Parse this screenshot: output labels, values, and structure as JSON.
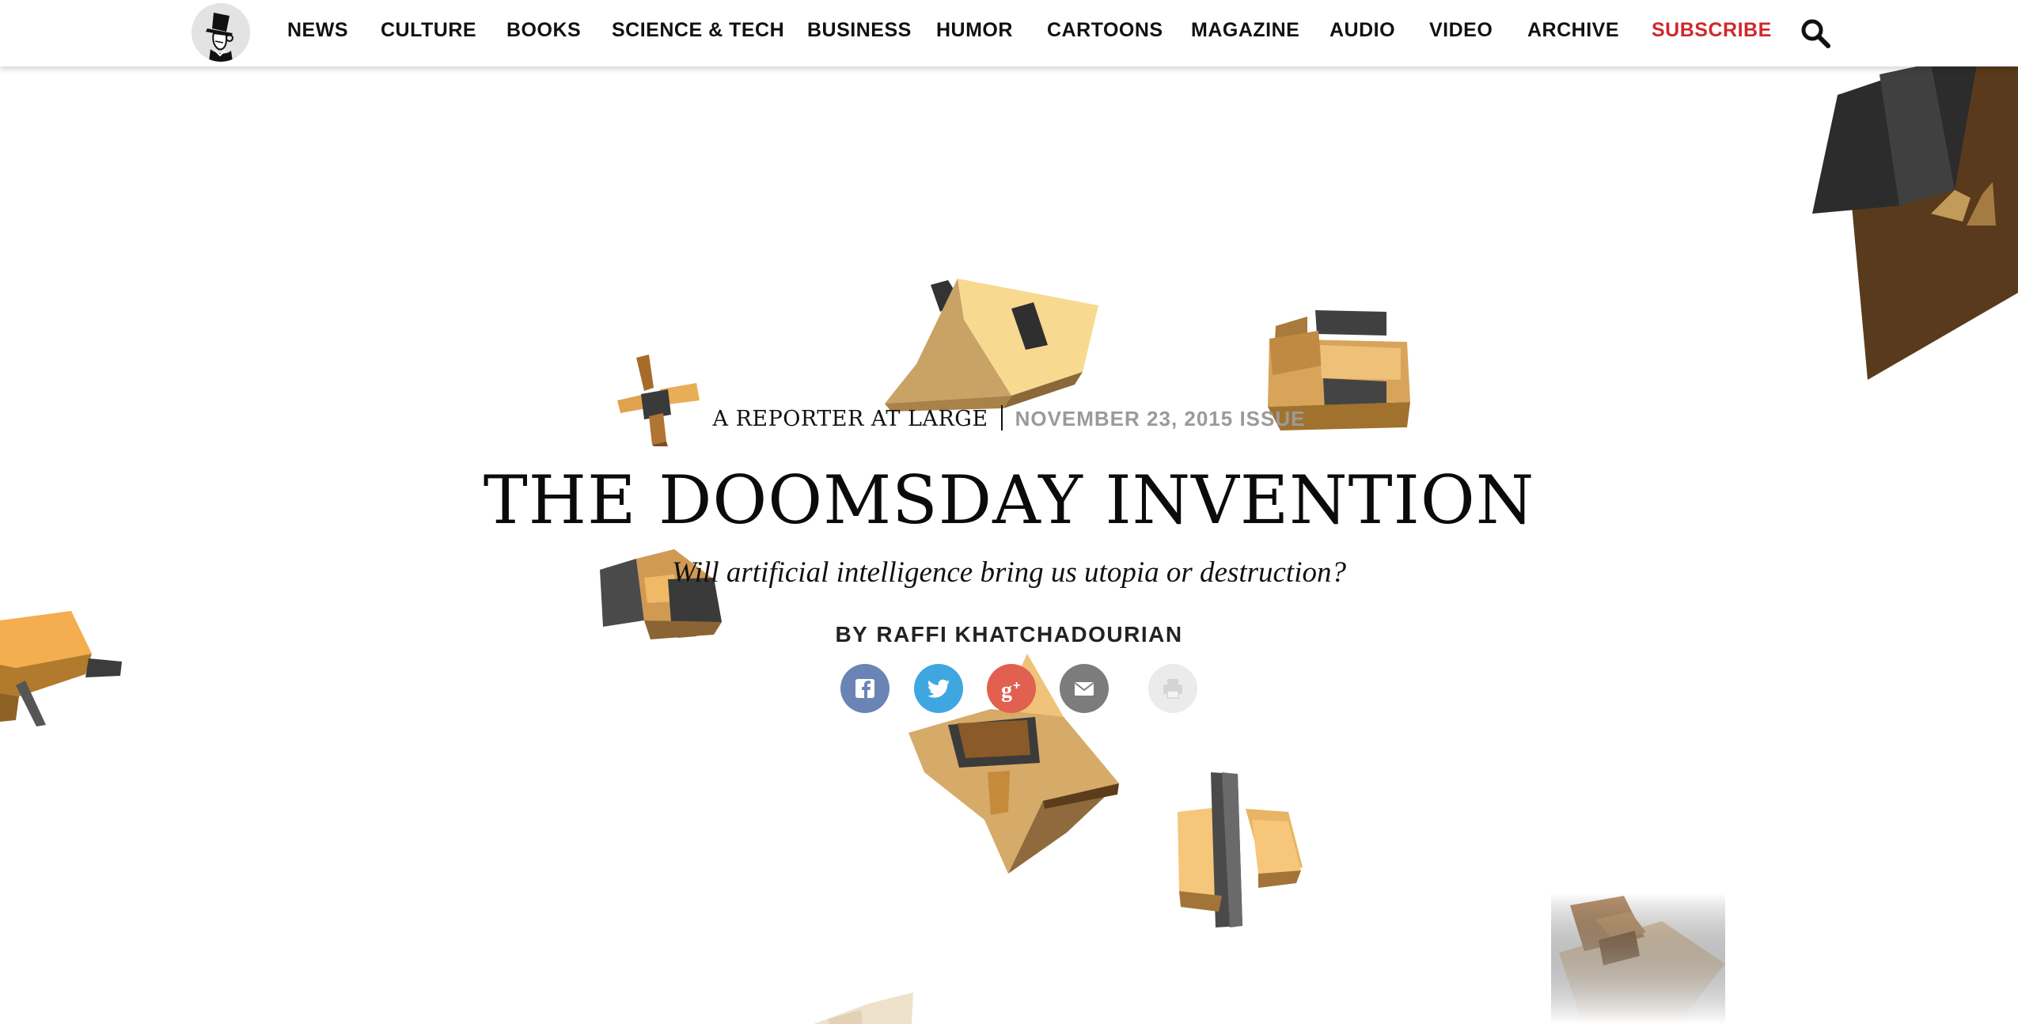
{
  "nav": {
    "logo_icon": "eustace-tilley-logo-icon",
    "items": [
      {
        "label": "NEWS"
      },
      {
        "label": "CULTURE"
      },
      {
        "label": "BOOKS"
      },
      {
        "label": "SCIENCE & TECH"
      },
      {
        "label": "BUSINESS"
      },
      {
        "label": "HUMOR"
      },
      {
        "label": "CARTOONS"
      },
      {
        "label": "MAGAZINE"
      },
      {
        "label": "AUDIO"
      },
      {
        "label": "VIDEO"
      },
      {
        "label": "ARCHIVE"
      }
    ],
    "subscribe_label": "SUBSCRIBE",
    "search_icon": "search-icon"
  },
  "article": {
    "rubric": "A REPORTER AT LARGE",
    "issue_date": "NOVEMBER 23, 2015 ISSUE",
    "headline": "THE DOOMSDAY INVENTION",
    "dek": "Will artificial intelligence bring us utopia or destruction?",
    "byline_prefix": "BY",
    "author": "RAFFI KHATCHADOURIAN"
  },
  "share": {
    "icons": [
      "facebook-icon",
      "twitter-icon",
      "google-plus-icon",
      "email-icon",
      "print-icon"
    ]
  },
  "colors": {
    "subscribe": "#d0282d",
    "issue_date": "#9a9a9a",
    "facebook": "#6b84b6",
    "twitter": "#3fa7e0",
    "google_plus": "#e1604f",
    "email": "#7c7c7c",
    "print": "#ebebeb",
    "shape_tan": "#c9a266",
    "shape_light": "#f4d898",
    "shape_dark": "#3a3a3a",
    "shape_brown": "#6b4522"
  }
}
